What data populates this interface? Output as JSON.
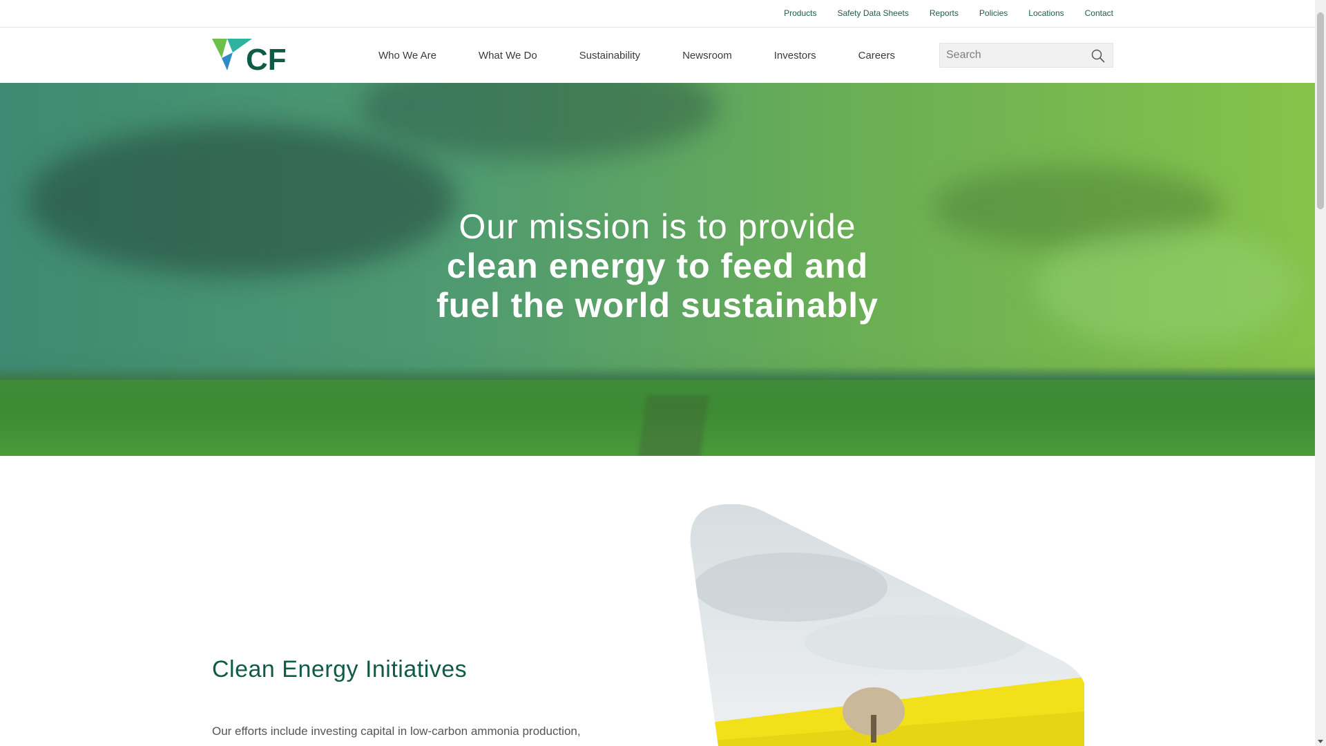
{
  "utility_nav": {
    "items": [
      {
        "label": "Products"
      },
      {
        "label": "Safety Data Sheets"
      },
      {
        "label": "Reports"
      },
      {
        "label": "Policies"
      },
      {
        "label": "Locations"
      },
      {
        "label": "Contact"
      }
    ]
  },
  "brand": {
    "logo_text": "CF",
    "logo_icon": "cf-triangle-logo-icon",
    "primary_color": "#0f5b45",
    "accent_green": "#6cc04a",
    "accent_blue": "#2e8bc9"
  },
  "main_nav": {
    "items": [
      {
        "label": "Who We Are"
      },
      {
        "label": "What We Do"
      },
      {
        "label": "Sustainability"
      },
      {
        "label": "Newsroom"
      },
      {
        "label": "Investors"
      },
      {
        "label": "Careers"
      }
    ]
  },
  "search": {
    "placeholder": "Search",
    "value": "",
    "icon": "search-icon"
  },
  "hero": {
    "line1": "Our mission is to provide",
    "line2": "clean energy to feed and",
    "line3": "fuel the world sustainably"
  },
  "section": {
    "title": "Clean Energy Initiatives",
    "body": "Our efforts include investing capital in low-carbon ammonia production, collaborations with industry leaders and organization memberships"
  }
}
